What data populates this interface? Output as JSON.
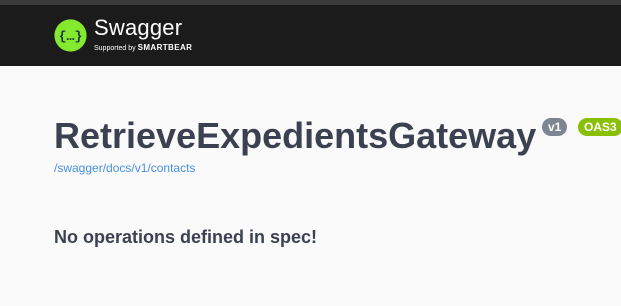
{
  "header": {
    "logo_name": "Swagger",
    "logo_sub_prefix": "Supported by",
    "logo_sub_brand": "SMARTBEAR",
    "logo_icon": "swagger-braces-icon",
    "accent_color": "#85ea2d",
    "background_color": "#1b1b1b"
  },
  "info": {
    "title": "RetrieveExpedientsGateway",
    "version_badge": "v1",
    "oas_badge": "OAS3",
    "spec_url": "/swagger/docs/v1/contacts",
    "badge_colors": {
      "version": "#7d8492",
      "oas": "#89bf04"
    }
  },
  "main": {
    "message": "No operations defined in spec!"
  }
}
